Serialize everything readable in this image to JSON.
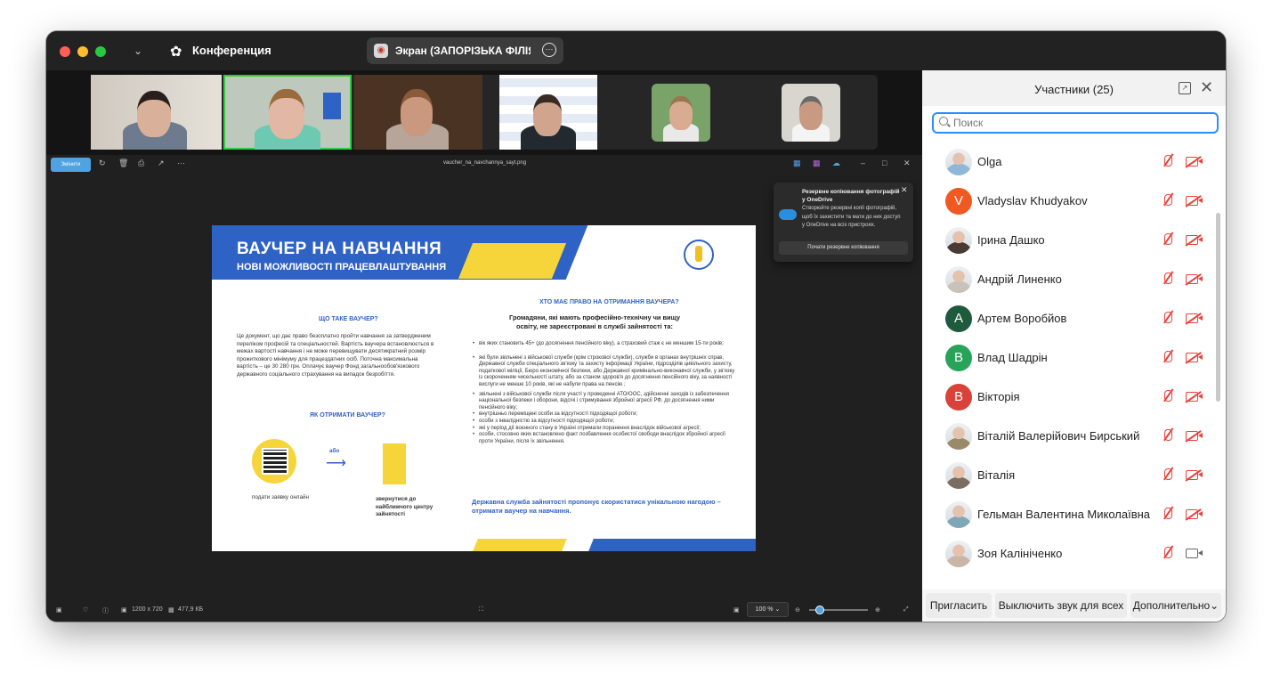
{
  "app": {
    "title": "Конференция",
    "share_label": "Экран (ЗАПОРІЗЬКА ФІЛІЯ ..."
  },
  "colors": {
    "accent": "#2d8cff",
    "muted": "#e8413a",
    "slide_blue": "#2f62c5",
    "slide_yellow": "#f6d53a"
  },
  "viewer": {
    "edit_label": "Змінити",
    "filename": "vaucher_na_navchannya_sayt.png",
    "dims": "1200 x 720",
    "size": "477,9 КБ",
    "zoom": "100 %"
  },
  "onedrive": {
    "title": "Резервне копіювання фотографій у OneDrive",
    "body": "Створюйте резервні копії фотографій, щоб їх захистити та мати до них доступ у OneDrive на всіх пристроях.",
    "button": "Почати резервне копіювання"
  },
  "slide": {
    "title": "ВАУЧЕР НА НАВЧАННЯ",
    "subtitle": "НОВІ МОЖЛИВОСТІ ПРАЦЕВЛАШТУВАННЯ",
    "what_heading": "ЩО ТАКЕ ВАУЧЕР?",
    "what_text": "Це документ, що дає право безоплатно пройти навчання за затвердженим переліком професій та спеціальностей. Вартість ваучера встановлюється в межах вартості навчання і не може перевищувати десятикратний розмір прожиткового мінімуму для працездатних осіб. Поточна максимальна вартість – це 30 280 грн. Оплачує ваучер Фонд загальнообов'язкового державного соціального страхування на випадок безробіття.",
    "how_heading": "ЯК ОТРИМАТИ ВАУЧЕР?",
    "or_label": "або",
    "online_label": "подати заявку онлайн",
    "center_label": "звернутися до найближчого центру зайнятості",
    "who_heading": "ХТО МАЄ ПРАВО НА ОТРИМАННЯ ВАУЧЕРА?",
    "who_main": "Громадяни, які мають професійно-технічну чи вищу освіту, не зареєстровані в службі зайнятості та:",
    "bullets": [
      "вік яких становить 45+ (до досягнення пенсійного віку), а страховий стаж є не меншим 15-ти років;",
      "які були звільнені з військової служби (крім строкової служби), служби в органах внутрішніх справ, Державної служби спеціального зв'язку та захисту інформації України, підрозділів цивільного захисту, податкової міліції, Бюро економічної безпеки, або Державної кримінально-виконавчої служби, у зв'язку із скороченням чисельності штату, або за станом здоров'я до досягнення пенсійного віку, за наявності вислуги не менше 10 років, які не набули права на пенсію ;",
      "звільнені з військової служби після участі у проведенні АТО/ООС, здійсненні заходів із забезпечення національної безпеки і оборони, відсічі і стримування збройної агресії РФ, до досягнення ними пенсійного віку;",
      "внутрішньо переміщені особи за відсутності підходящої роботи;",
      "особи з інвалідністю за відсутності підходящої роботи;",
      "які у період дії воєнного стану в Україні отримали поранення внаслідок військової агресії;",
      "особи, стосовно яких встановлено факт позбавлення особистої свободи внаслідок збройної агресії проти України, після їх звільнення."
    ],
    "closing": "Державна служба зайнятості пропонує скористатися унікальною нагодою – отримати ваучер на навчання."
  },
  "participants": {
    "title": "Участники (25)",
    "search_placeholder": "Поиск",
    "list": [
      {
        "name": "Olga",
        "initial": "",
        "color": "#8fb7d8",
        "photo": true,
        "video_on": false
      },
      {
        "name": "Vladyslav Khudyakov",
        "initial": "V",
        "color": "#f05a22",
        "photo": false,
        "video_on": false
      },
      {
        "name": "Ірина Дашко",
        "initial": "",
        "color": "#4a3a34",
        "photo": true,
        "video_on": false
      },
      {
        "name": "Андрій Линенко",
        "initial": "",
        "color": "#c9c2b8",
        "photo": true,
        "video_on": false
      },
      {
        "name": "Артем Воробйов",
        "initial": "А",
        "color": "#1e5a3c",
        "photo": false,
        "video_on": false
      },
      {
        "name": "Влад Шадрін",
        "initial": "В",
        "color": "#27a35a",
        "photo": false,
        "video_on": false
      },
      {
        "name": "Вікторія",
        "initial": "В",
        "color": "#d8423a",
        "photo": false,
        "video_on": false
      },
      {
        "name": "Віталій Валерійович Бирський",
        "initial": "",
        "color": "#9a8a6a",
        "photo": true,
        "video_on": false
      },
      {
        "name": "Віталія",
        "initial": "",
        "color": "#7a6e62",
        "photo": true,
        "video_on": false
      },
      {
        "name": "Гельман Валентина Миколаївна",
        "initial": "",
        "color": "#7fa7b6",
        "photo": true,
        "video_on": false
      },
      {
        "name": "Зоя Калініченко",
        "initial": "",
        "color": "#c9b6a8",
        "photo": true,
        "video_on": true
      }
    ],
    "footer": {
      "invite": "Пригласить",
      "mute_all": "Выключить звук для всех",
      "more": "Дополнительно"
    }
  }
}
